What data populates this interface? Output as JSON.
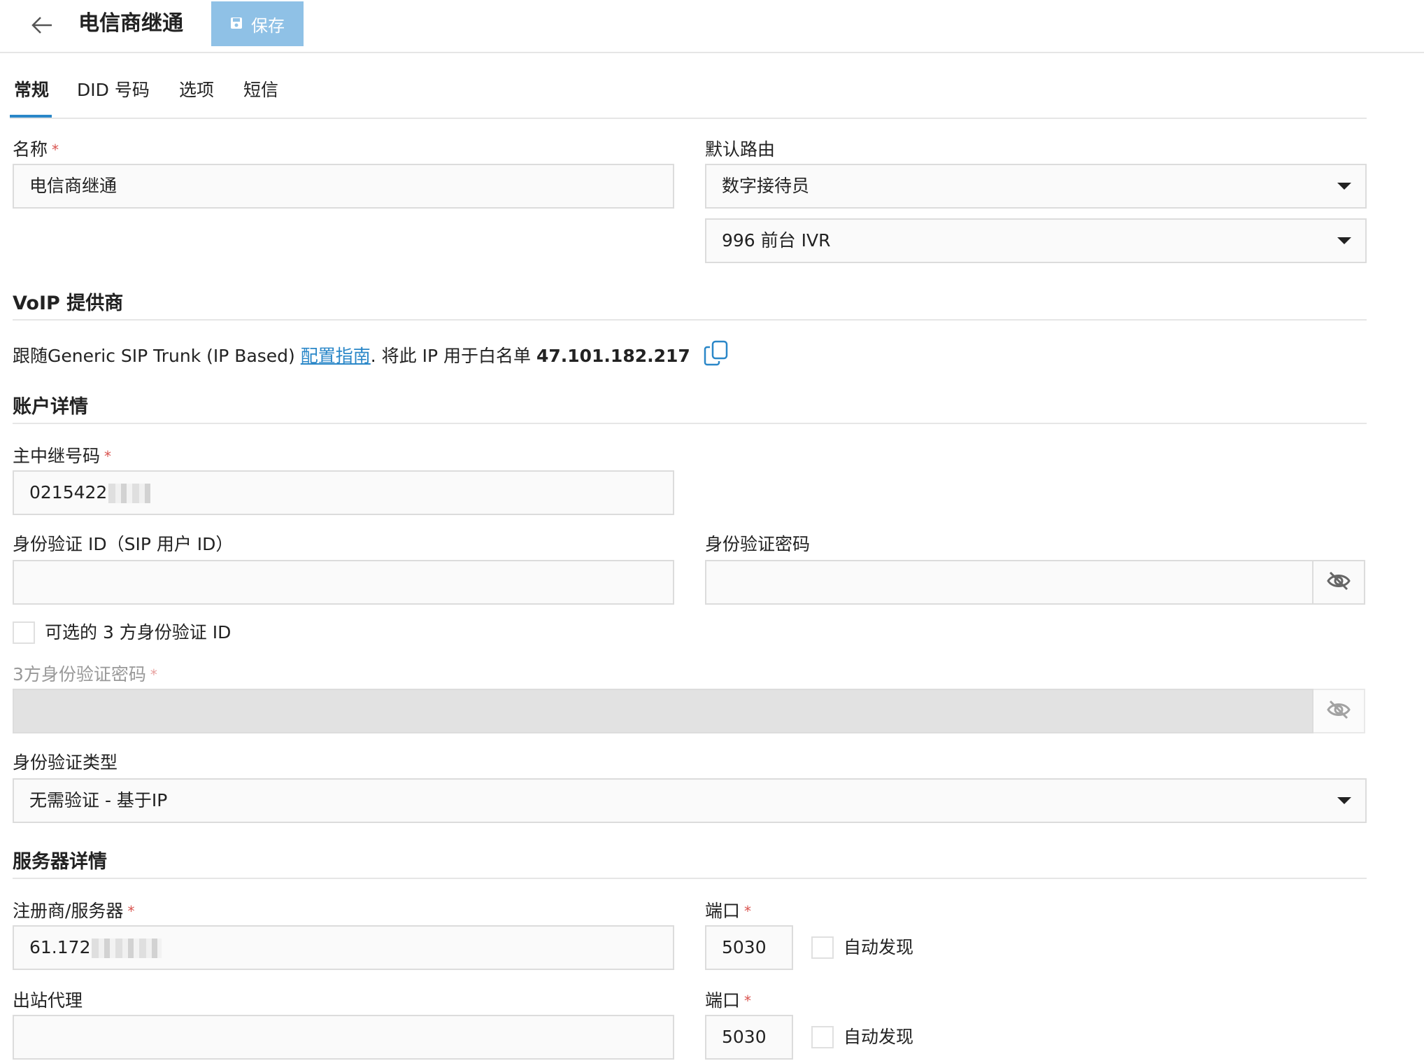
{
  "header": {
    "title": "电信商继通",
    "save_label": "保存"
  },
  "tabs": [
    {
      "label": "常规",
      "active": true
    },
    {
      "label": "DID 号码"
    },
    {
      "label": "选项"
    },
    {
      "label": "短信"
    }
  ],
  "general": {
    "name_label": "名称",
    "name_value": "电信商继通",
    "default_route_label": "默认路由",
    "default_route_value": "数字接待员",
    "default_route_target": "996 前台 IVR"
  },
  "voip": {
    "heading": "VoIP 提供商",
    "text_before": "跟随Generic SIP Trunk (IP Based) ",
    "link": "配置指南",
    "text_after": ". 将此 IP 用于白名单 ",
    "ip": "47.101.182.217"
  },
  "account": {
    "heading": "账户详情",
    "main_number_label": "主中继号码",
    "main_number_value": "0215422",
    "auth_id_label": "身份验证 ID（SIP 用户 ID）",
    "auth_id_value": "",
    "auth_password_label": "身份验证密码",
    "auth_password_value": "",
    "optional_3p_label": "可选的 3 方身份验证 ID",
    "password_3p_label": "3方身份验证密码",
    "auth_type_label": "身份验证类型",
    "auth_type_value": "无需验证 - 基于IP"
  },
  "server": {
    "heading": "服务器详情",
    "registrar_label": "注册商/服务器",
    "registrar_value": "61.172",
    "port_label": "端口",
    "port1_value": "5030",
    "auto_discover_label": "自动发现",
    "proxy_label": "出站代理",
    "proxy_value": "",
    "port2_value": "5030"
  },
  "colors": {
    "accent": "#2a87c8",
    "save_button": "#8fc1e6",
    "required": "#d9534f"
  },
  "icons": [
    "back-arrow-icon",
    "save-icon",
    "caret-down-icon",
    "eye-off-icon",
    "copy-icon"
  ]
}
